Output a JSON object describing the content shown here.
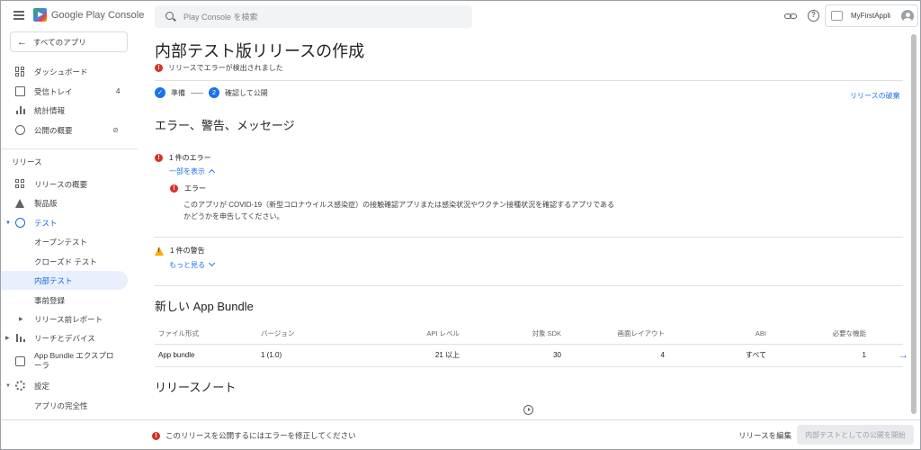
{
  "app": {
    "logo_text": "Google Play Console"
  },
  "search": {
    "placeholder": "Play Console を検索"
  },
  "account": {
    "name": "MyFirstAppli"
  },
  "sidebar": {
    "back_label": "すべてのアプリ",
    "items_top": [
      {
        "label": "ダッシュボード"
      },
      {
        "label": "受信トレイ",
        "badge": "4"
      },
      {
        "label": "統計情報"
      },
      {
        "label": "公開の概要"
      }
    ],
    "section_label": "リリース",
    "items_release": [
      {
        "label": "リリースの概要"
      },
      {
        "label": "製品版"
      },
      {
        "label": "テスト"
      },
      {
        "label": "オープンテスト"
      },
      {
        "label": "クローズド テスト"
      },
      {
        "label": "内部テスト"
      },
      {
        "label": "事前登録"
      },
      {
        "label": "リリース前レポート"
      },
      {
        "label": "リーチとデバイス"
      },
      {
        "label": "App Bundle エクスプローラ"
      },
      {
        "label": "設定"
      },
      {
        "label": "アプリの完全性"
      }
    ]
  },
  "main": {
    "title": "内部テスト版リリースの作成",
    "subtitle_error": "リリースでエラーが検出されました",
    "stepper": {
      "step1_label": "準備",
      "step2_number": "2",
      "step2_label": "確認して公開"
    },
    "discard_link": "リリースの破棄",
    "messages_heading": "エラー、警告、メッセージ",
    "error_count": "1 件のエラー",
    "show_less": "一部を表示",
    "error_title": "エラー",
    "error_body": "このアプリが COVID-19（新型コロナウイルス感染症）の接触確認アプリまたは感染状況やワクチン接種状況を確認するアプリであるかどうかを申告してください。",
    "warning_count": "1 件の警告",
    "show_more": "もっと見る",
    "bundle_heading": "新しい App Bundle",
    "table": {
      "headers": [
        "ファイル形式",
        "バージョン",
        "API レベル",
        "対象 SDK",
        "画面レイアウト",
        "ABI",
        "必要な機能"
      ],
      "rows": [
        [
          "App bundle",
          "1 (1.0)",
          "21 以上",
          "30",
          "4",
          "すべて",
          "1"
        ]
      ]
    },
    "notes_heading": "リリースノート"
  },
  "bottom": {
    "error_message": "このリリースを公開するにはエラーを修正してください",
    "edit_label": "リリースを編集",
    "start_label": "内部テストとしての公開を開始"
  }
}
